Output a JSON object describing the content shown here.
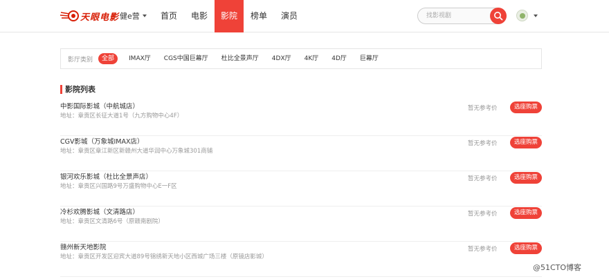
{
  "header": {
    "logo_text": "天眼电影",
    "city": "健e营",
    "nav": [
      {
        "label": "首页",
        "active": false
      },
      {
        "label": "电影",
        "active": false
      },
      {
        "label": "影院",
        "active": true
      },
      {
        "label": "榜单",
        "active": false
      },
      {
        "label": "演员",
        "active": false
      }
    ],
    "search_placeholder": "找影视剧"
  },
  "filter": {
    "label": "影厅类别",
    "tags": [
      {
        "label": "全部",
        "active": true
      },
      {
        "label": "IMAX厅",
        "active": false
      },
      {
        "label": "CGS中国巨幕厅",
        "active": false
      },
      {
        "label": "杜比全景声厅",
        "active": false
      },
      {
        "label": "4DX厅",
        "active": false
      },
      {
        "label": "4K厅",
        "active": false
      },
      {
        "label": "4D厅",
        "active": false
      },
      {
        "label": "巨幕厅",
        "active": false
      }
    ]
  },
  "list": {
    "title": "影院列表",
    "cinemas": [
      {
        "name": "中影国际影城（中航城店）",
        "address": "地址：章贡区长征大道1号（九方购物中心4F）",
        "price": "暂无参考价",
        "button": "选座购票"
      },
      {
        "name": "CGV影城（万象城IMAX店）",
        "address": "地址：章贡区章江新区新赣州大道华润中心万象城301商铺",
        "price": "暂无参考价",
        "button": "选座购票"
      },
      {
        "name": "银河欢乐影城（杜比全景声店）",
        "address": "地址：章贡区兴国路9号万盛购物中心E一F区",
        "price": "暂无参考价",
        "button": "选座购票"
      },
      {
        "name": "冷杉欢腾影城（文清路店）",
        "address": "地址：章贡区文清路6号（原赣南剧院）",
        "price": "暂无参考价",
        "button": "选座购票"
      },
      {
        "name": "赣州新天地影院",
        "address": "地址：章贡区开发区迎宾大道89号锦绣新天地小区西城广场三楼（原镜店影城）",
        "price": "暂无参考价",
        "button": "选座购票"
      }
    ]
  },
  "watermark": "@51CTO博客",
  "colors": {
    "accent": "#ef4238",
    "logo": "#d81e06"
  }
}
